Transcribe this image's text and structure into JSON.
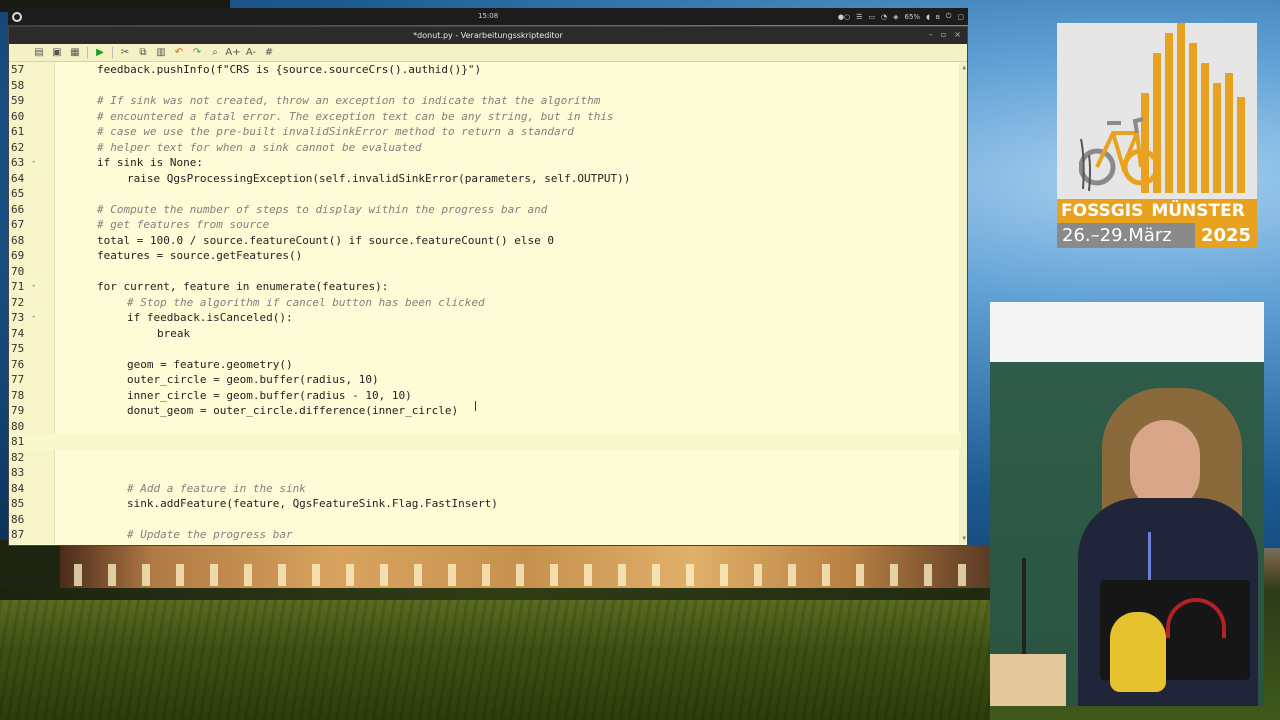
{
  "system_bar": {
    "clock": "15:08",
    "battery": "65%"
  },
  "editor": {
    "title": "*donut.py - Verarbeitungsskripteditor",
    "toolbar": {
      "font_larger": "A+",
      "font_smaller": "A-",
      "comment": "#"
    },
    "lines": [
      {
        "n": "57",
        "fold": "",
        "indent": 8,
        "text": "feedback.pushInfo(f\"CRS is {source.sourceCrs().authid()}\")",
        "kind": "code"
      },
      {
        "n": "58",
        "fold": "",
        "indent": 0,
        "text": "",
        "kind": "code"
      },
      {
        "n": "59",
        "fold": "",
        "indent": 8,
        "text": "# If sink was not created, throw an exception to indicate that the algorithm",
        "kind": "comment"
      },
      {
        "n": "60",
        "fold": "",
        "indent": 8,
        "text": "# encountered a fatal error. The exception text can be any string, but in this",
        "kind": "comment"
      },
      {
        "n": "61",
        "fold": "",
        "indent": 8,
        "text": "# case we use the pre-built invalidSinkError method to return a standard",
        "kind": "comment"
      },
      {
        "n": "62",
        "fold": "",
        "indent": 8,
        "text": "# helper text for when a sink cannot be evaluated",
        "kind": "comment"
      },
      {
        "n": "63",
        "fold": "-",
        "indent": 8,
        "text": "if sink is None:",
        "kind": "code"
      },
      {
        "n": "64",
        "fold": "",
        "indent": 12,
        "text": "raise QgsProcessingException(self.invalidSinkError(parameters, self.OUTPUT))",
        "kind": "code"
      },
      {
        "n": "65",
        "fold": "",
        "indent": 0,
        "text": "",
        "kind": "code"
      },
      {
        "n": "66",
        "fold": "",
        "indent": 8,
        "text": "# Compute the number of steps to display within the progress bar and",
        "kind": "comment"
      },
      {
        "n": "67",
        "fold": "",
        "indent": 8,
        "text": "# get features from source",
        "kind": "comment"
      },
      {
        "n": "68",
        "fold": "",
        "indent": 8,
        "text": "total = 100.0 / source.featureCount() if source.featureCount() else 0",
        "kind": "code"
      },
      {
        "n": "69",
        "fold": "",
        "indent": 8,
        "text": "features = source.getFeatures()",
        "kind": "code"
      },
      {
        "n": "70",
        "fold": "",
        "indent": 0,
        "text": "",
        "kind": "code"
      },
      {
        "n": "71",
        "fold": "-",
        "indent": 8,
        "text": "for current, feature in enumerate(features):",
        "kind": "code"
      },
      {
        "n": "72",
        "fold": "",
        "indent": 12,
        "text": "# Stop the algorithm if cancel button has been clicked",
        "kind": "comment"
      },
      {
        "n": "73",
        "fold": "-",
        "indent": 12,
        "text": "if feedback.isCanceled():",
        "kind": "code"
      },
      {
        "n": "74",
        "fold": "",
        "indent": 16,
        "text": "break",
        "kind": "code"
      },
      {
        "n": "75",
        "fold": "",
        "indent": 0,
        "text": "",
        "kind": "code"
      },
      {
        "n": "76",
        "fold": "",
        "indent": 12,
        "text": "geom = feature.geometry()",
        "kind": "code"
      },
      {
        "n": "77",
        "fold": "",
        "indent": 12,
        "text": "outer_circle = geom.buffer(radius, 10)",
        "kind": "code"
      },
      {
        "n": "78",
        "fold": "",
        "indent": 12,
        "text": "inner_circle = geom.buffer(radius - 10, 10)",
        "kind": "code"
      },
      {
        "n": "79",
        "fold": "",
        "indent": 12,
        "text": "donut_geom = outer_circle.difference(inner_circle)",
        "kind": "code"
      },
      {
        "n": "80",
        "fold": "",
        "indent": 0,
        "text": "",
        "kind": "code"
      },
      {
        "n": "81",
        "fold": "",
        "indent": 0,
        "text": "",
        "kind": "code"
      },
      {
        "n": "82",
        "fold": "",
        "indent": 0,
        "text": "",
        "kind": "code"
      },
      {
        "n": "83",
        "fold": "",
        "indent": 0,
        "text": "",
        "kind": "code"
      },
      {
        "n": "84",
        "fold": "",
        "indent": 12,
        "text": "# Add a feature in the sink",
        "kind": "comment"
      },
      {
        "n": "85",
        "fold": "",
        "indent": 12,
        "text": "sink.addFeature(feature, QgsFeatureSink.Flag.FastInsert)",
        "kind": "code"
      },
      {
        "n": "86",
        "fold": "",
        "indent": 0,
        "text": "",
        "kind": "code"
      },
      {
        "n": "87",
        "fold": "",
        "indent": 12,
        "text": "# Update the progress bar",
        "kind": "comment"
      }
    ]
  },
  "logo": {
    "name_left": "FOSSGIS",
    "name_right": "MÜNSTER",
    "dates": "26.–29.März",
    "year": "2025"
  },
  "colors": {
    "editor_bg": "#fefcd6",
    "logo_accent": "#e8a21f",
    "comment": "#808080",
    "number": "#b22222"
  }
}
